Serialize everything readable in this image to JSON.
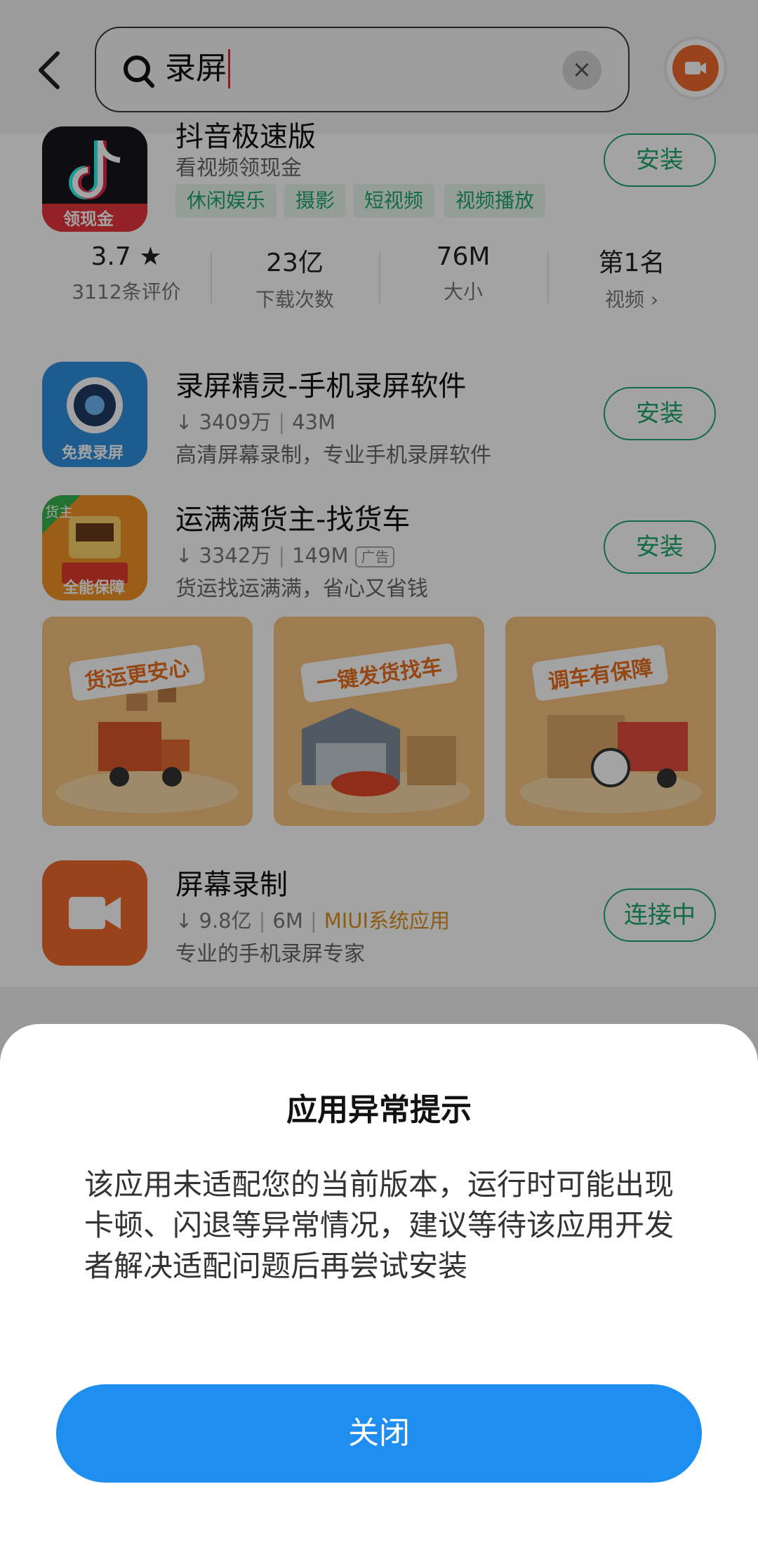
{
  "search": {
    "query": "录屏",
    "clear": "×"
  },
  "apps": [
    {
      "name": "抖音极速版",
      "subtitle": "看视频领现金",
      "icon_badge": "领现金",
      "tags": [
        "休闲娱乐",
        "摄影",
        "短视频",
        "视频播放"
      ],
      "action": "安装",
      "stats": [
        {
          "value": "3.7 ★",
          "label": "3112条评价"
        },
        {
          "value": "23亿",
          "label": "下载次数"
        },
        {
          "value": "76M",
          "label": "大小"
        },
        {
          "value": "第1名",
          "label": "视频 ›"
        }
      ]
    },
    {
      "name": "录屏精灵-手机录屏软件",
      "downloads": "↓ 3409万",
      "size": "43M",
      "desc": "高清屏幕录制，专业手机录屏软件",
      "icon_label": "免费录屏",
      "action": "安装"
    },
    {
      "name": "运满满货主-找货车",
      "downloads": "↓ 3342万",
      "size": "149M",
      "badge": "广告",
      "desc": "货运找运满满，省心又省钱",
      "icon_label": "全能保障",
      "icon_corner": "货主",
      "action": "安装",
      "banners": [
        "货运更安心",
        "一键发货找车",
        "调车有保障"
      ]
    },
    {
      "name": "屏幕录制",
      "downloads": "↓ 9.8亿",
      "size": "6M",
      "badge": "MIUI系统应用",
      "desc": "专业的手机录屏专家",
      "action": "连接中"
    }
  ],
  "dialog": {
    "title": "应用异常提示",
    "message": "该应用未适配您的当前版本，运行时可能出现卡顿、闪退等异常情况，建议等待该应用开发者解决适配问题后再尝试安装",
    "button": "关闭"
  },
  "colors": {
    "accent": "#1ea76f",
    "primary_button": "#1e8ff0",
    "record": "#ef6a2c"
  }
}
